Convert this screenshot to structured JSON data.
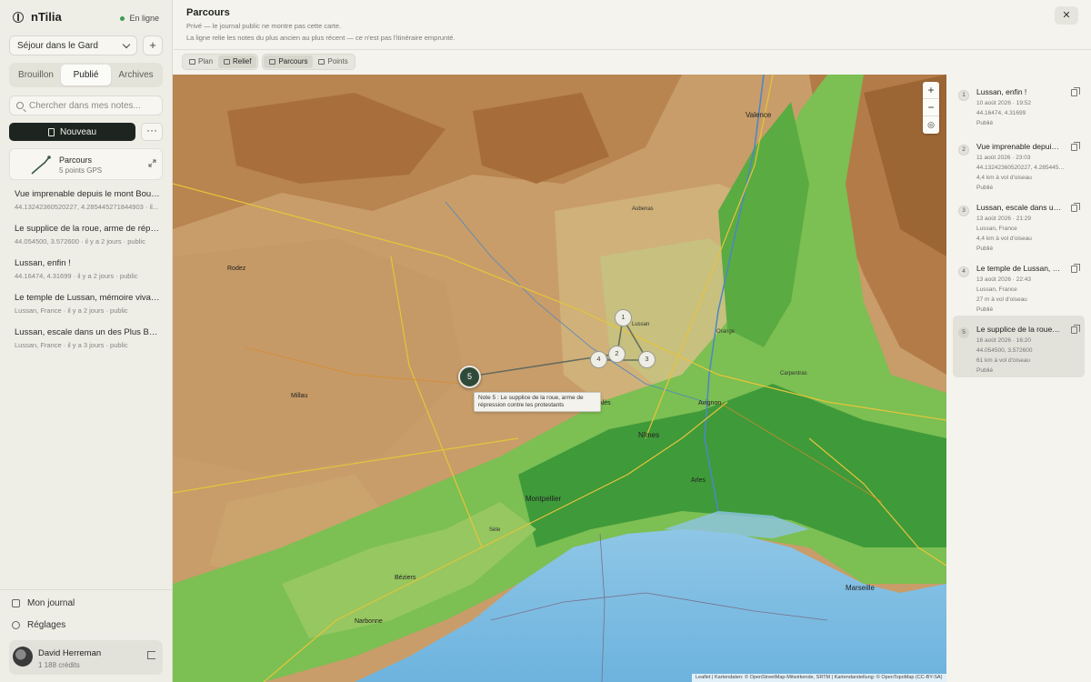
{
  "app": {
    "name": "nTilia",
    "status": "En ligne"
  },
  "sidebar": {
    "trip_select": "Séjour dans le Gard",
    "tabs": [
      {
        "label": "Brouillon",
        "active": false
      },
      {
        "label": "Publié",
        "active": true
      },
      {
        "label": "Archives",
        "active": false
      }
    ],
    "search_placeholder": "Chercher dans mes notes...",
    "new_label": "Nouveau",
    "more_label": "···",
    "parcours": {
      "title": "Parcours",
      "subtitle": "5 points GPS"
    },
    "notes": [
      {
        "title": "Vue imprenable depuis le mont Bouquet",
        "meta": "44.13242360520227, 4.285445271844903 · il..."
      },
      {
        "title": "Le supplice de la roue, arme de répressi...",
        "meta": "44.054500, 3.572600 · il y a 2 jours · public"
      },
      {
        "title": "Lussan, enfin !",
        "meta": "44.16474, 4.31699 · il y a 2 jours · public"
      },
      {
        "title": "Le temple de Lussan, mémoire vivante d...",
        "meta": "Lussan, France · il y a 2 jours · public"
      },
      {
        "title": "Lussan, escale dans un des Plus Beaux ...",
        "meta": "Lussan, France · il y a 3 jours · public"
      }
    ],
    "links": {
      "journal": "Mon journal",
      "settings": "Réglages"
    },
    "user": {
      "name": "David Herreman",
      "credits": "1 188 crédits"
    }
  },
  "header": {
    "title": "Parcours",
    "subtitle1": "Privé — le journal public ne montre pas cette carte.",
    "subtitle2": "La ligne relie les notes du plus ancien au plus récent — ce n'est pas l'itinéraire emprunté.",
    "close": "✕"
  },
  "toolbar": {
    "base": [
      {
        "label": "Plan",
        "active": false
      },
      {
        "label": "Relief",
        "active": true
      }
    ],
    "mode": [
      {
        "label": "Parcours",
        "active": true
      },
      {
        "label": "Points",
        "active": false
      }
    ]
  },
  "map": {
    "zoom_in": "+",
    "zoom_out": "−",
    "locate": "◎",
    "tooltip": "Note 5 : Le supplice de la roue, arme de répression contre les protestants",
    "attribution": "Leaflet | Kartendaten: © OpenStreetMap-Mitwirkende, SRTM | Kartendarstellung: © OpenTopoMap (CC-BY-SA)",
    "markers": [
      "1",
      "2",
      "3",
      "4",
      "5"
    ],
    "labels": [
      "Valence",
      "Aubenas",
      "Nîmes",
      "Montpellier",
      "Avignon",
      "Marseille",
      "Béziers",
      "Narbonne",
      "Lussan",
      "Alès",
      "Arles",
      "Millau",
      "Rodez",
      "Carpentras",
      "Sète",
      "Orange"
    ]
  },
  "panel": {
    "items": [
      {
        "num": "1",
        "title": "Lussan, enfin !",
        "line1": "10 août 2026 · 19:52",
        "line2": "44.16474, 4.31699",
        "line3": "Publié",
        "active": false
      },
      {
        "num": "2",
        "title": "Vue imprenable depuis le mont Bouquet",
        "line1": "11 août 2026 · 23:03",
        "line2": "44.13242360520227, 4.285445271844903",
        "line3": "4,4 km à vol d'oiseau",
        "line4": "Publié",
        "active": false
      },
      {
        "num": "3",
        "title": "Lussan, escale dans un des Plus Beaux Villages",
        "line1": "13 août 2026 · 21:29",
        "line2": "Lussan, France",
        "line3": "4,4 km à vol d'oiseau",
        "line4": "Publié",
        "active": false
      },
      {
        "num": "4",
        "title": "Le temple de Lussan, mémoire vivante",
        "line1": "13 août 2026 · 22:43",
        "line2": "Lussan, France",
        "line3": "27 m à vol d'oiseau",
        "line4": "Publié",
        "active": false
      },
      {
        "num": "5",
        "title": "Le supplice de la roue, arme de répression",
        "line1": "16 août 2026 · 16:20",
        "line2": "44.054500, 3.572600",
        "line3": "61 km à vol d'oiseau",
        "line4": "Publié",
        "active": true
      }
    ]
  }
}
